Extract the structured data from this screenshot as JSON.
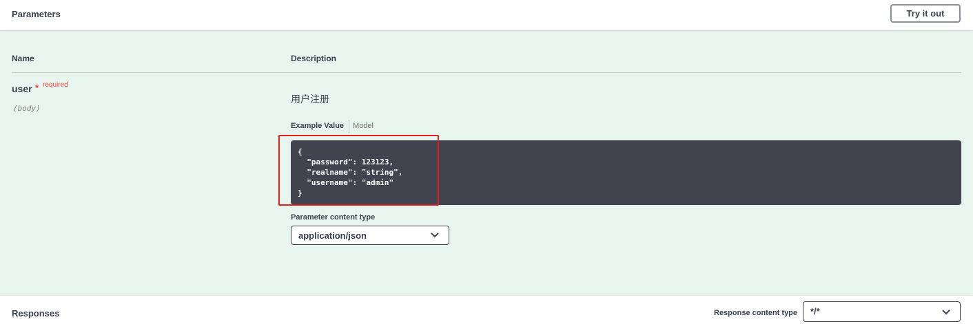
{
  "parameters": {
    "title": "Parameters",
    "try_button": "Try it out",
    "columns": {
      "name": "Name",
      "description": "Description"
    },
    "param": {
      "name": "user",
      "star": "*",
      "required": "required",
      "in": "(body)",
      "description": "用户注册",
      "tabs": {
        "example": "Example Value",
        "model": "Model"
      },
      "example_value": "{\n  \"password\": 123123,\n  \"realname\": \"string\",\n  \"username\": \"admin\"\n}",
      "content_type_label": "Parameter content type",
      "content_type_value": "application/json"
    }
  },
  "responses": {
    "title": "Responses",
    "content_type_label": "Response content type",
    "content_type_value": "*/*"
  },
  "colors": {
    "required": "#f93e3e",
    "code_bg": "#41444e",
    "section_bg": "#e8f5ee",
    "highlight_box": "#e0201f"
  },
  "icons": {
    "dropdown": "chevron-down-icon"
  }
}
